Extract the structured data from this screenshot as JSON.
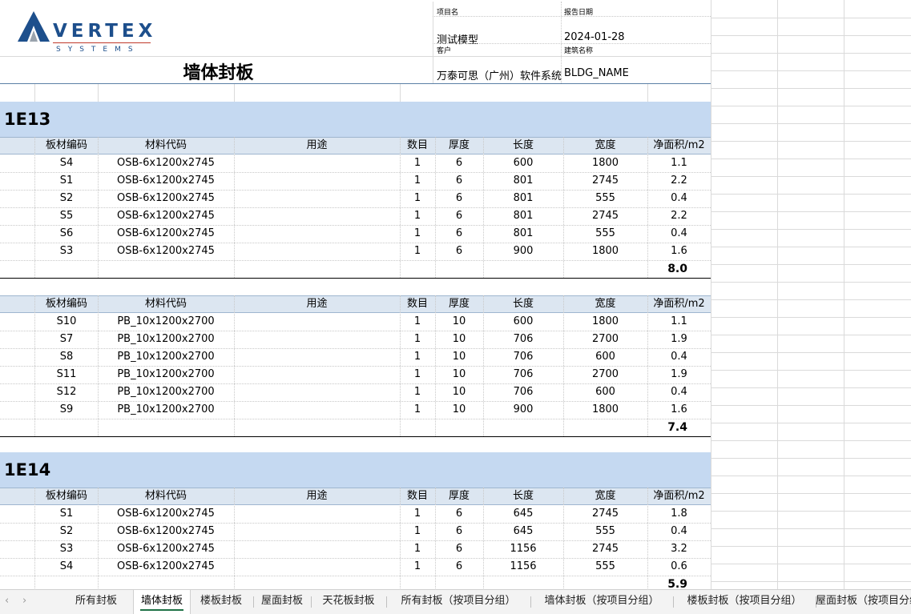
{
  "logo": {
    "name": "VERTEX",
    "sub": "SYSTEMS"
  },
  "header": {
    "title": "墙体封板",
    "project_label": "项目名",
    "project_value": "测试模型",
    "date_label": "报告日期",
    "date_value": "2024-01-28",
    "client_label": "客户",
    "client_value": "万泰可思（广州）软件系统",
    "building_label": "建筑名称",
    "building_value": "BLDG_NAME"
  },
  "columns": [
    "板材编码",
    "材料代码",
    "用途",
    "数目",
    "厚度",
    "长度",
    "宽度",
    "净面积/m2"
  ],
  "sections": [
    {
      "name": "1E13",
      "tables": [
        {
          "rows": [
            [
              "S4",
              "OSB-6x1200x2745",
              "",
              "1",
              "6",
              "600",
              "1800",
              "1.1"
            ],
            [
              "S1",
              "OSB-6x1200x2745",
              "",
              "1",
              "6",
              "801",
              "2745",
              "2.2"
            ],
            [
              "S2",
              "OSB-6x1200x2745",
              "",
              "1",
              "6",
              "801",
              "555",
              "0.4"
            ],
            [
              "S5",
              "OSB-6x1200x2745",
              "",
              "1",
              "6",
              "801",
              "2745",
              "2.2"
            ],
            [
              "S6",
              "OSB-6x1200x2745",
              "",
              "1",
              "6",
              "801",
              "555",
              "0.4"
            ],
            [
              "S3",
              "OSB-6x1200x2745",
              "",
              "1",
              "6",
              "900",
              "1800",
              "1.6"
            ]
          ],
          "total": "8.0"
        },
        {
          "rows": [
            [
              "S10",
              "PB_10x1200x2700",
              "",
              "1",
              "10",
              "600",
              "1800",
              "1.1"
            ],
            [
              "S7",
              "PB_10x1200x2700",
              "",
              "1",
              "10",
              "706",
              "2700",
              "1.9"
            ],
            [
              "S8",
              "PB_10x1200x2700",
              "",
              "1",
              "10",
              "706",
              "600",
              "0.4"
            ],
            [
              "S11",
              "PB_10x1200x2700",
              "",
              "1",
              "10",
              "706",
              "2700",
              "1.9"
            ],
            [
              "S12",
              "PB_10x1200x2700",
              "",
              "1",
              "10",
              "706",
              "600",
              "0.4"
            ],
            [
              "S9",
              "PB_10x1200x2700",
              "",
              "1",
              "10",
              "900",
              "1800",
              "1.6"
            ]
          ],
          "total": "7.4"
        }
      ]
    },
    {
      "name": "1E14",
      "tables": [
        {
          "rows": [
            [
              "S1",
              "OSB-6x1200x2745",
              "",
              "1",
              "6",
              "645",
              "2745",
              "1.8"
            ],
            [
              "S2",
              "OSB-6x1200x2745",
              "",
              "1",
              "6",
              "645",
              "555",
              "0.4"
            ],
            [
              "S3",
              "OSB-6x1200x2745",
              "",
              "1",
              "6",
              "1156",
              "2745",
              "3.2"
            ],
            [
              "S4",
              "OSB-6x1200x2745",
              "",
              "1",
              "6",
              "1156",
              "555",
              "0.6"
            ]
          ],
          "total": "5.9"
        }
      ]
    }
  ],
  "tabs": {
    "nav_prev": "‹",
    "nav_next": "›",
    "items": [
      "所有封板",
      "墙体封板",
      "楼板封板",
      "屋面封板",
      "天花板封板",
      "所有封板（按项目分组）",
      "墙体封板（按项目分组）",
      "楼板封板（按项目分组）",
      "屋面封板（按项目分组）"
    ],
    "active": 1
  }
}
